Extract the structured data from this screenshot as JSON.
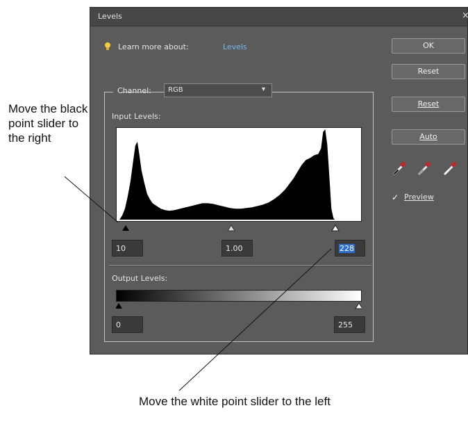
{
  "annotations": {
    "left": "Move the black point slider to the right",
    "bottom": "Move the white point slider to the left"
  },
  "dialog": {
    "title": "Levels",
    "close_icon": "close-icon",
    "learn_more_label": "Learn more about:",
    "learn_more_link": "Levels",
    "channel_label": "Channel:",
    "channel_value": "RGB",
    "input_levels_label": "Input Levels:",
    "input_black": "10",
    "input_gamma": "1.00",
    "input_white": "228",
    "output_levels_label": "Output Levels:",
    "output_black": "0",
    "output_white": "255",
    "buttons": {
      "ok": "OK",
      "reset_1": "Reset",
      "reset_2": "Reset",
      "auto": "Auto"
    },
    "preview_label": "Preview",
    "preview_checked": true,
    "icons": [
      "lightbulb-icon",
      "black-eyedropper-icon",
      "gray-eyedropper-icon",
      "white-eyedropper-icon",
      "checkmark-icon"
    ],
    "colors": {
      "dialog_bg": "#5b5b5b",
      "link": "#76b7ef",
      "selection": "#2c6fd1",
      "eyedropper": "#c0282f"
    }
  }
}
